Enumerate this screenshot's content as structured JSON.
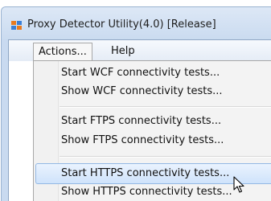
{
  "window": {
    "title": "Proxy Detector Utility(4.0) [Release]"
  },
  "menubar": {
    "items": [
      {
        "label": "Actions..."
      },
      {
        "label": "Help"
      }
    ]
  },
  "actions_menu": {
    "items": [
      {
        "label": "Start WCF connectivity tests..."
      },
      {
        "label": "Show WCF connectivity tests..."
      },
      {
        "label": "Start FTPS connectivity tests..."
      },
      {
        "label": "Show FTPS connectivity tests..."
      },
      {
        "label": "Start HTTPS connectivity tests..."
      },
      {
        "label": "Show HTTPS connectivity tests..."
      }
    ],
    "highlighted_item": "Start HTTPS connectivity tests..."
  },
  "colors": {
    "title_bar": "#cadbf0",
    "menu_background": "#f3f3f3",
    "highlight": "#cfe3fb",
    "highlight_border": "#93b8e4"
  },
  "icons": {
    "app": "app-icon",
    "cursor": "mouse-pointer-icon"
  }
}
